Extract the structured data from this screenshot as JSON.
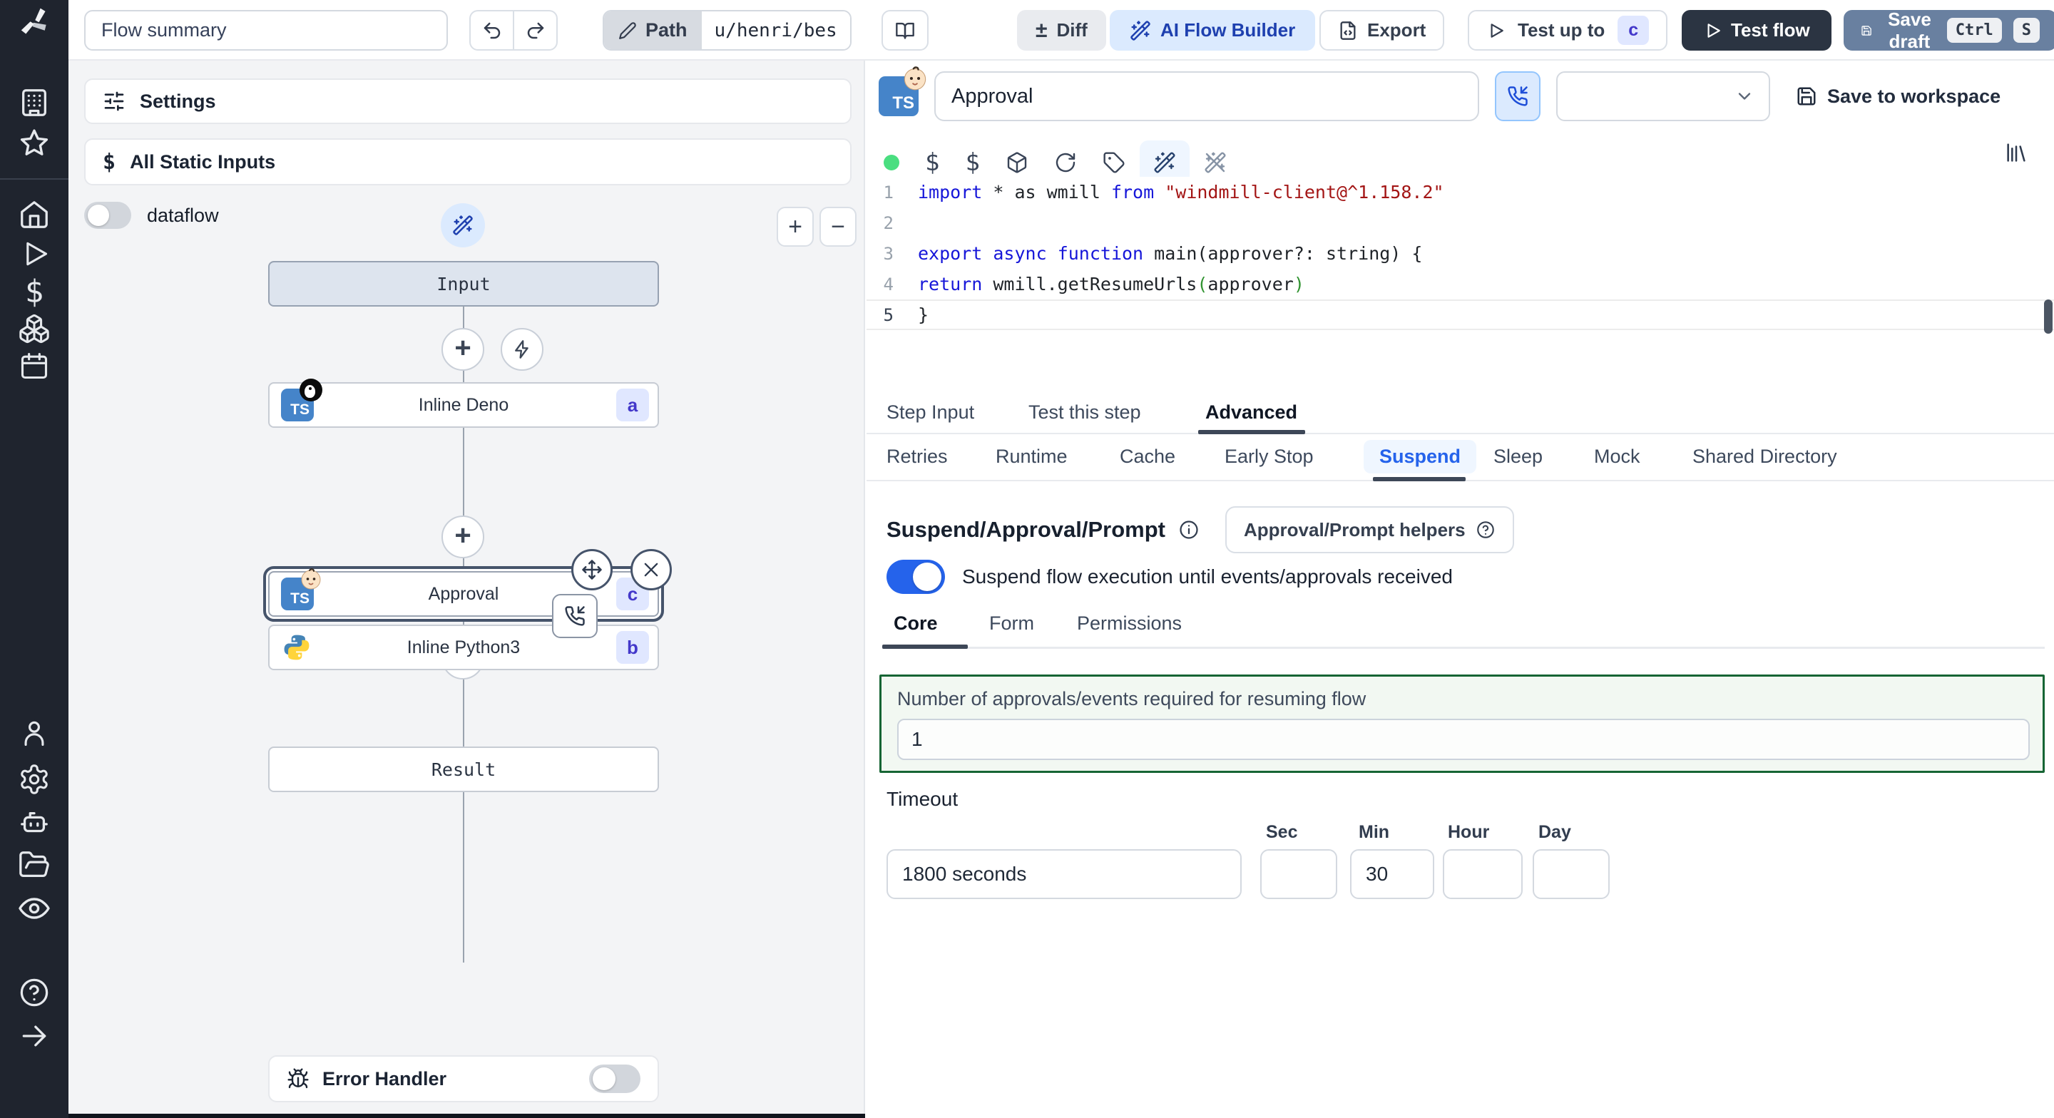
{
  "topbar": {
    "flow_summary": "Flow summary",
    "path_label": "Path",
    "path_value": "u/henri/bes",
    "diff_symbol": "±",
    "diff_label": "Diff",
    "ai_flow_builder": "AI Flow Builder",
    "export_label": "Export",
    "test_up_to": "Test up to",
    "test_up_to_badge": "c",
    "test_flow": "Test flow",
    "save_draft": "Save draft",
    "kbd_ctrl": "Ctrl",
    "kbd_s": "S"
  },
  "sidebar": {
    "icons": [
      "windmill-logo",
      "workspace-building",
      "favorites-star",
      "home",
      "runs-play",
      "variables-dollar",
      "resources-boxes",
      "schedules-calendar",
      "users-person",
      "instance-settings-gear",
      "workers-robot",
      "folders-folder",
      "audit-logs-eye",
      "help-question",
      "expand-arrow-right"
    ]
  },
  "flow_panel": {
    "settings": "Settings",
    "static_inputs": "All Static Inputs",
    "static_inputs_icon": "$",
    "dataflow": "dataflow",
    "zoom_in": "+",
    "zoom_out": "−",
    "nodes": {
      "input_label": "Input",
      "deno_ts": "TS",
      "deno_label": "Inline Deno",
      "deno_badge": "a",
      "approval_ts": "TS",
      "approval_label": "Approval",
      "approval_badge": "c",
      "python_label": "Inline Python3",
      "python_badge": "b",
      "result_label": "Result"
    },
    "error_handler": "Error Handler"
  },
  "step_panel": {
    "ts_badge": "TS",
    "name_value": "Approval",
    "save_to_workspace": "Save to workspace",
    "code": {
      "lines": [
        {
          "num": "1",
          "current": false,
          "tokens": [
            {
              "c": "kw",
              "t": "import"
            },
            {
              "c": "pl",
              "t": " * as wmill "
            },
            {
              "c": "kw",
              "t": "from"
            },
            {
              "c": "pl",
              "t": " "
            },
            {
              "c": "str",
              "t": "\"windmill-client@^1.158.2\""
            }
          ]
        },
        {
          "num": "2",
          "current": false,
          "tokens": []
        },
        {
          "num": "3",
          "current": false,
          "tokens": [
            {
              "c": "kw",
              "t": "export"
            },
            {
              "c": "pl",
              "t": " "
            },
            {
              "c": "kw",
              "t": "async"
            },
            {
              "c": "pl",
              "t": " "
            },
            {
              "c": "kw",
              "t": "function"
            },
            {
              "c": "pl",
              "t": " main(approver?: string) {"
            }
          ]
        },
        {
          "num": "4",
          "current": false,
          "tokens": [
            {
              "c": "pl",
              "t": "  "
            },
            {
              "c": "kw",
              "t": "return"
            },
            {
              "c": "pl",
              "t": " wmill.getResumeUrls"
            },
            {
              "c": "brk",
              "t": "("
            },
            {
              "c": "pl",
              "t": "approver"
            },
            {
              "c": "brk",
              "t": ")"
            }
          ]
        },
        {
          "num": "5",
          "current": true,
          "tokens": [
            {
              "c": "pl",
              "t": "}"
            }
          ]
        }
      ]
    },
    "tabs": [
      "Step Input",
      "Test this step",
      "Advanced"
    ],
    "subtabs": [
      "Retries",
      "Runtime",
      "Cache",
      "Early Stop",
      "Suspend",
      "Sleep",
      "Mock",
      "Shared Directory"
    ],
    "suspend": {
      "heading": "Suspend/Approval/Prompt",
      "helpers": "Approval/Prompt helpers",
      "toggle_label": "Suspend flow execution until events/approvals received",
      "tabs": [
        "Core",
        "Form",
        "Permissions"
      ],
      "approvals_label": "Number of approvals/events required for resuming flow",
      "approvals_value": "1",
      "timeout_label": "Timeout",
      "timeout_value": "1800 seconds",
      "unit_labels": [
        "Sec",
        "Min",
        "Hour",
        "Day"
      ],
      "sec_value": "",
      "min_value": "30",
      "hour_value": "",
      "day_value": ""
    }
  },
  "colors": {
    "accent_blue": "#2563eb",
    "badge_bg": "#e0e7ff",
    "badge_text": "#4338ca",
    "green_border": "#166534",
    "save_draft_bg": "#6980a0",
    "dark_button_bg": "#2b3442",
    "status_dot": "#4ade80"
  }
}
